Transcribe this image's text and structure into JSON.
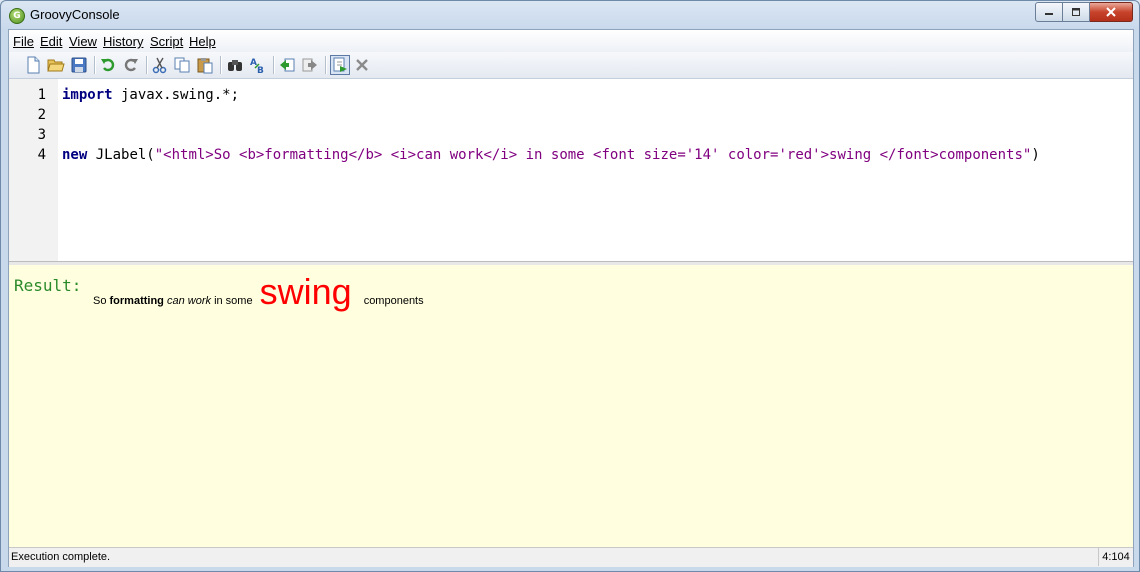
{
  "window": {
    "title": "GroovyConsole",
    "icon_letter": "G"
  },
  "menu": [
    "File",
    "Edit",
    "View",
    "History",
    "Script",
    "Help"
  ],
  "toolbar": [
    "new-file",
    "open",
    "save",
    "undo",
    "redo",
    "cut",
    "copy",
    "paste",
    "find",
    "replace",
    "previous-history",
    "next-history",
    "run-script",
    "interrupt"
  ],
  "editor": {
    "line_numbers": [
      "1",
      "2",
      "3",
      "4"
    ],
    "line1": {
      "kw": "import",
      "rest": " javax.swing.*;"
    },
    "line4": {
      "kw": "new",
      "pre": " JLabel(",
      "str": "\"<html>So <b>formatting</b> <i>can work</i> in some <font size='14' color='red'>swing </font>components\"",
      "post": ")"
    }
  },
  "output": {
    "label": "Result:",
    "so": "So ",
    "formatting": "formatting",
    "can_work": "can work",
    "in_some": "in some ",
    "swing": "swing",
    "components": "components",
    "swing_color": "#ff0000"
  },
  "status": {
    "message": "Execution complete.",
    "position": "4:104"
  }
}
